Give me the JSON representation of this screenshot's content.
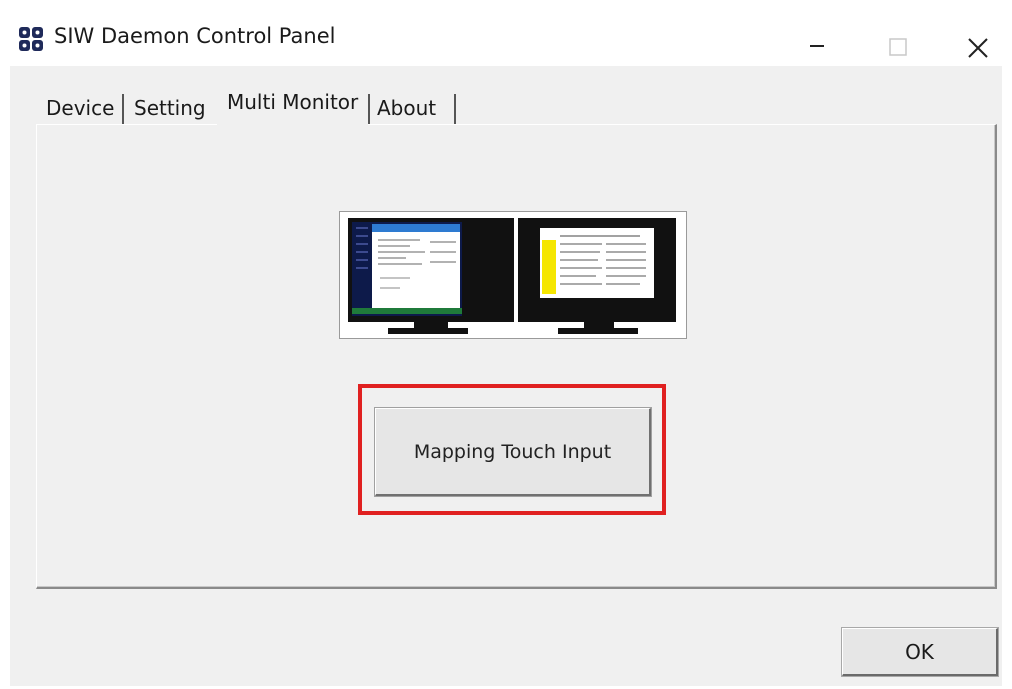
{
  "window": {
    "title": "SIW Daemon Control Panel",
    "icon": "siw-app-icon"
  },
  "titlebar_buttons": {
    "minimize_icon": "minimize-icon",
    "maximize_icon": "maximize-icon",
    "close_icon": "close-icon"
  },
  "tabs": [
    {
      "label": "Device",
      "active": false
    },
    {
      "label": "Setting",
      "active": false
    },
    {
      "label": "Multi Monitor",
      "active": true
    },
    {
      "label": "About",
      "active": false
    }
  ],
  "multi_monitor": {
    "illustration": "dual-monitor-illustration",
    "action_button_label": "Mapping Touch Input",
    "highlight_color": "#e02020"
  },
  "footer": {
    "ok_label": "OK"
  }
}
